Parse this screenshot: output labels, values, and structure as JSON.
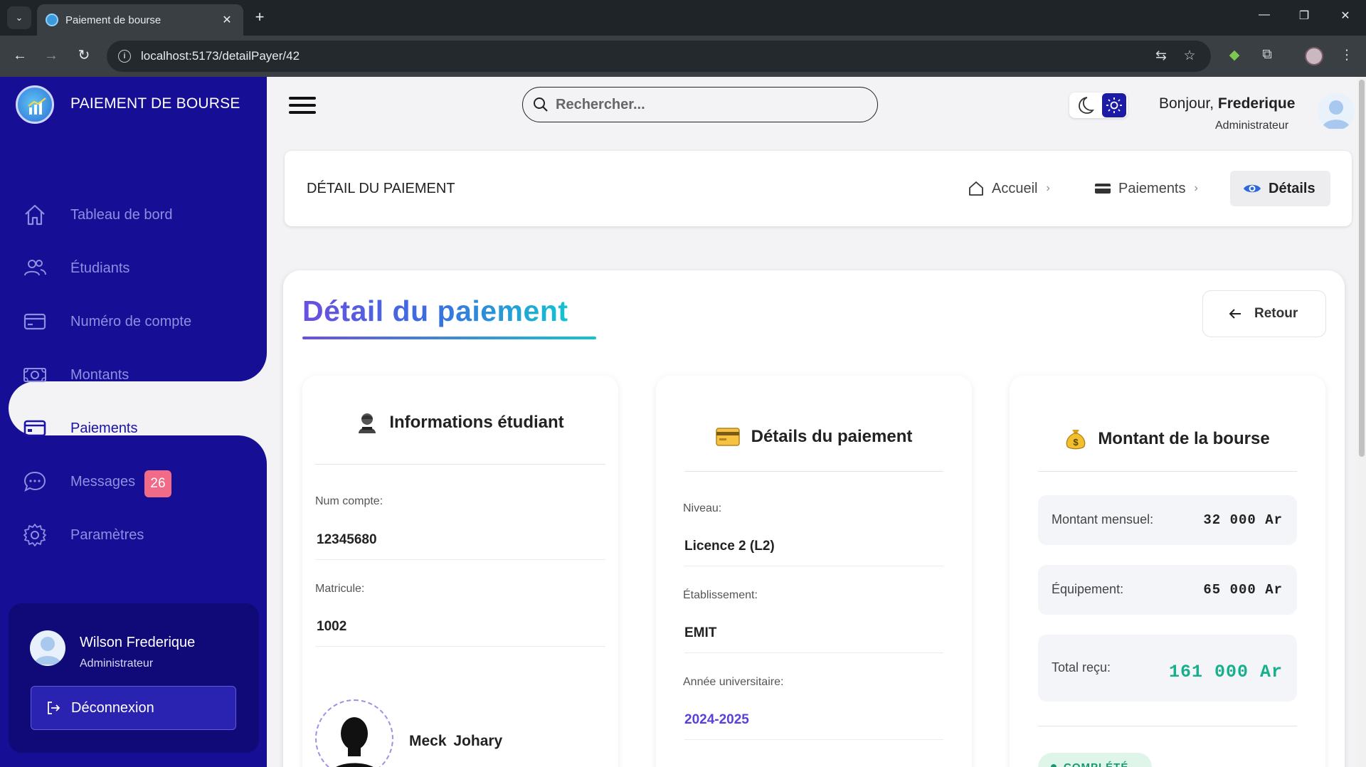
{
  "browser": {
    "tab_title": "Paiement de bourse",
    "url": "localhost:5173/detailPayer/42"
  },
  "sidebar": {
    "app_title": "PAIEMENT DE BOURSE",
    "items": [
      {
        "label": "Tableau de bord",
        "icon": "home-icon"
      },
      {
        "label": "Étudiants",
        "icon": "users-icon"
      },
      {
        "label": "Numéro de compte",
        "icon": "credit-card-icon"
      },
      {
        "label": "Montants",
        "icon": "money-icon"
      },
      {
        "label": "Paiements",
        "icon": "credit-card-icon",
        "active": true
      },
      {
        "label": "Messages",
        "icon": "chat-icon",
        "badge": "26"
      },
      {
        "label": "Paramètres",
        "icon": "gear-icon"
      }
    ],
    "user": {
      "name": "Wilson Frederique",
      "role": "Administrateur",
      "logout_label": "Déconnexion"
    }
  },
  "header": {
    "search_placeholder": "Rechercher...",
    "greeting_prefix": "Bonjour, ",
    "greeting_name": "Frederique",
    "role": "Administrateur"
  },
  "breadcrumb": {
    "page_label": "DÉTAIL DU PAIEMENT",
    "items": [
      "Accueil",
      "Paiements",
      "Détails"
    ]
  },
  "main": {
    "title": "Détail du paiement",
    "back_label": "Retour",
    "student_card": {
      "heading": "Informations étudiant",
      "fields": [
        {
          "label": "Num compte:",
          "value": "12345680"
        },
        {
          "label": "Matricule:",
          "value": "1002"
        }
      ],
      "name": "Meck  Johary"
    },
    "payment_card": {
      "heading": "Détails du paiement",
      "fields": [
        {
          "label": "Niveau:",
          "value": "Licence 2 (L2)"
        },
        {
          "label": "Établissement:",
          "value": "EMIT"
        },
        {
          "label": "Année universitaire:",
          "value": "2024-2025"
        }
      ]
    },
    "amount_card": {
      "heading": "Montant de la bourse",
      "monthly_label": "Montant mensuel:",
      "monthly_value": "32 000 Ar",
      "equipment_label": "Équipement:",
      "equipment_value": "65 000 Ar",
      "total_label": "Total reçu:",
      "total_value": "161 000 Ar",
      "status": "COMPLÉTÉ"
    }
  },
  "colors": {
    "sidebar_bg": "#160f96",
    "accent": "#5a40d8",
    "total_green": "#18b08c",
    "badge": "#f16a88"
  }
}
